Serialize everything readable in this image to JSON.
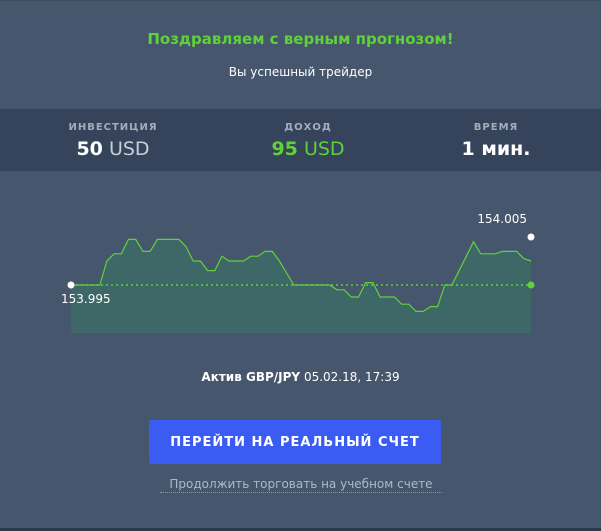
{
  "header": {
    "congrats": "Поздравляем с верным прогнозом!",
    "subtitle": "Вы успешный трейдер"
  },
  "stats": {
    "investment": {
      "label": "Инвестиция",
      "value": "50",
      "unit": "USD"
    },
    "income": {
      "label": "Доход",
      "value": "95",
      "unit": "USD"
    },
    "time": {
      "label": "Время",
      "value": "1 мин."
    }
  },
  "chart": {
    "start_label": "153.995",
    "end_label": "154.005",
    "colors": {
      "line": "#5fd13a",
      "fill": "#3d6b66",
      "baseline": "#5fd13a",
      "start_dot": "#ffffff",
      "end_dot": "#5fd13a"
    }
  },
  "chart_data": {
    "type": "line",
    "start_value": 153.995,
    "end_value": 154.005,
    "baseline": 153.995,
    "ylim": [
      153.985,
      154.0125
    ],
    "values": [
      153.995,
      153.995,
      153.995,
      153.995,
      153.995,
      154.0,
      154.0015,
      154.0015,
      154.0045,
      154.0045,
      154.002,
      154.002,
      154.0045,
      154.0045,
      154.0045,
      154.0045,
      154.003,
      154.0,
      154.0,
      153.998,
      153.998,
      154.001,
      154.0,
      154.0,
      154.0,
      154.001,
      154.001,
      154.002,
      154.002,
      154.0,
      153.9975,
      153.995,
      153.995,
      153.995,
      153.995,
      153.995,
      153.995,
      153.994,
      153.994,
      153.9925,
      153.9925,
      153.9955,
      153.9955,
      153.9925,
      153.9925,
      153.9925,
      153.991,
      153.991,
      153.9895,
      153.9895,
      153.9905,
      153.9905,
      153.995,
      153.995,
      153.998,
      154.001,
      154.004,
      154.0015,
      154.0015,
      154.0015,
      154.002,
      154.002,
      154.002,
      154.0005,
      154.0
    ]
  },
  "asset": {
    "label": "Актив GBP/JPY",
    "datetime": "05.02.18, 17:39"
  },
  "actions": {
    "real_account": "Перейти на реальный счет",
    "demo_continue": "Продолжить торговать на учебном счете"
  }
}
